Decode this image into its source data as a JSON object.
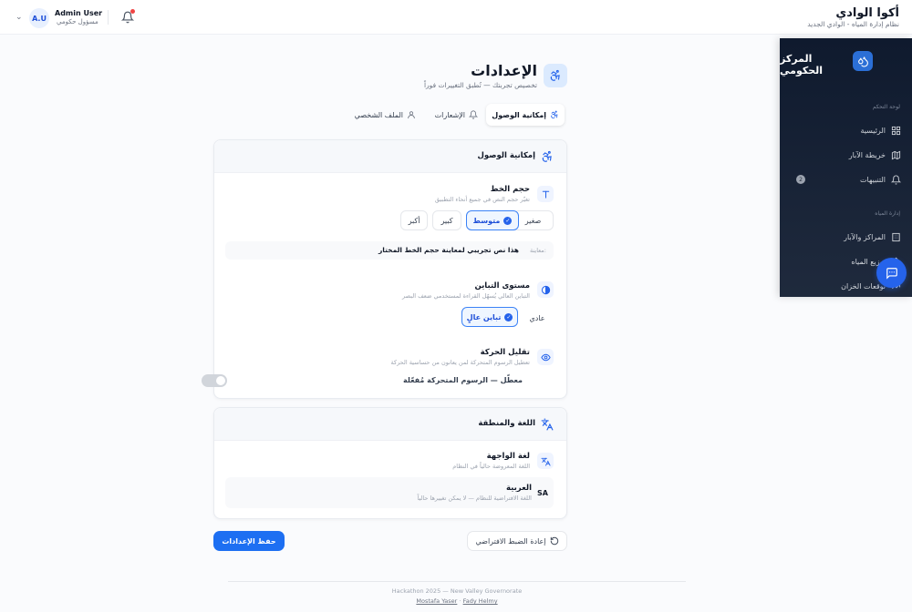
{
  "header": {
    "brand_title": "أكوا الوادي",
    "brand_subtitle": "نظام إدارة المياه - الوادي الجديد",
    "user_name": "Admin User",
    "user_role": "مسؤول حكومي",
    "avatar_initials": "A.U"
  },
  "page": {
    "title": "الإعدادات",
    "subtitle": "تخصيص تجربتك — تُطبق التغييرات فوراً"
  },
  "tabs": [
    {
      "label": "إمكانية الوصول",
      "icon": "accessibility-icon"
    },
    {
      "label": "الإشعارات",
      "icon": "bell-icon"
    },
    {
      "label": "الملف الشخصي",
      "icon": "user-icon"
    }
  ],
  "accessibility_card": {
    "title": "إمكانية الوصول",
    "font_size": {
      "title": "حجم الخط",
      "desc": "تغيّر حجم النص في جميع أنحاء التطبيق",
      "options": [
        "صغير",
        "متوسط",
        "كبير",
        "أكبر"
      ],
      "selected": "متوسط",
      "preview_label": "معاينة:",
      "preview_text": "هذا نص تجريبي لمعاينة حجم الخط المختار"
    },
    "contrast": {
      "title": "مستوى التباين",
      "desc": "التباين العالي يُسهّل القراءة لمستخدمي ضعف البصر",
      "options": [
        "عادي",
        "تباين عالٍ"
      ],
      "selected": "تباين عالٍ"
    },
    "motion": {
      "title": "تقليل الحركة",
      "desc": "تعطيل الرسوم المتحركة لمن يعانون من حساسية الحركة",
      "state_text": "معطّل — الرسوم المتحركة مُفعّلة",
      "enabled": false
    }
  },
  "language_card": {
    "title": "اللغة والمنطقة",
    "ui_language": {
      "title": "لغة الواجهة",
      "desc": "اللغة المعروضة حالياً في النظام"
    },
    "current_language": {
      "code": "SA",
      "name": "العربية",
      "desc": "اللغة الافتراضية للنظام — لا يمكن تغييرها حالياً"
    }
  },
  "actions": {
    "save": "حفظ الإعدادات",
    "reset": "إعادة الضبط الافتراضي"
  },
  "footer": {
    "line1": "Hackathon 2025 — New Valley Governorate",
    "author1": "Mostafa Yaser",
    "separator": "·",
    "author2": "Fady Helmy"
  },
  "sidebar": {
    "title": "المركز الحكومي",
    "section_dashboard": "لوحة التحكم",
    "section_water": "إدارة المياه",
    "items": [
      {
        "label": "الرئيسية",
        "icon": "grid-icon"
      },
      {
        "label": "خريطة الآبار",
        "icon": "map-icon"
      },
      {
        "label": "التنبيهات",
        "icon": "bell-icon",
        "badge": "2"
      },
      {
        "label": "المراكز والآبار",
        "icon": "building-icon"
      },
      {
        "label": "توزيع المياه",
        "icon": "droplet-icon"
      },
      {
        "label": "توقعات الخزان",
        "icon": "trend-icon"
      }
    ]
  },
  "colors": {
    "accent": "#1d6ff2",
    "sidebar_bg": "#0f1a2e",
    "notification_dot": "#ef4444"
  }
}
